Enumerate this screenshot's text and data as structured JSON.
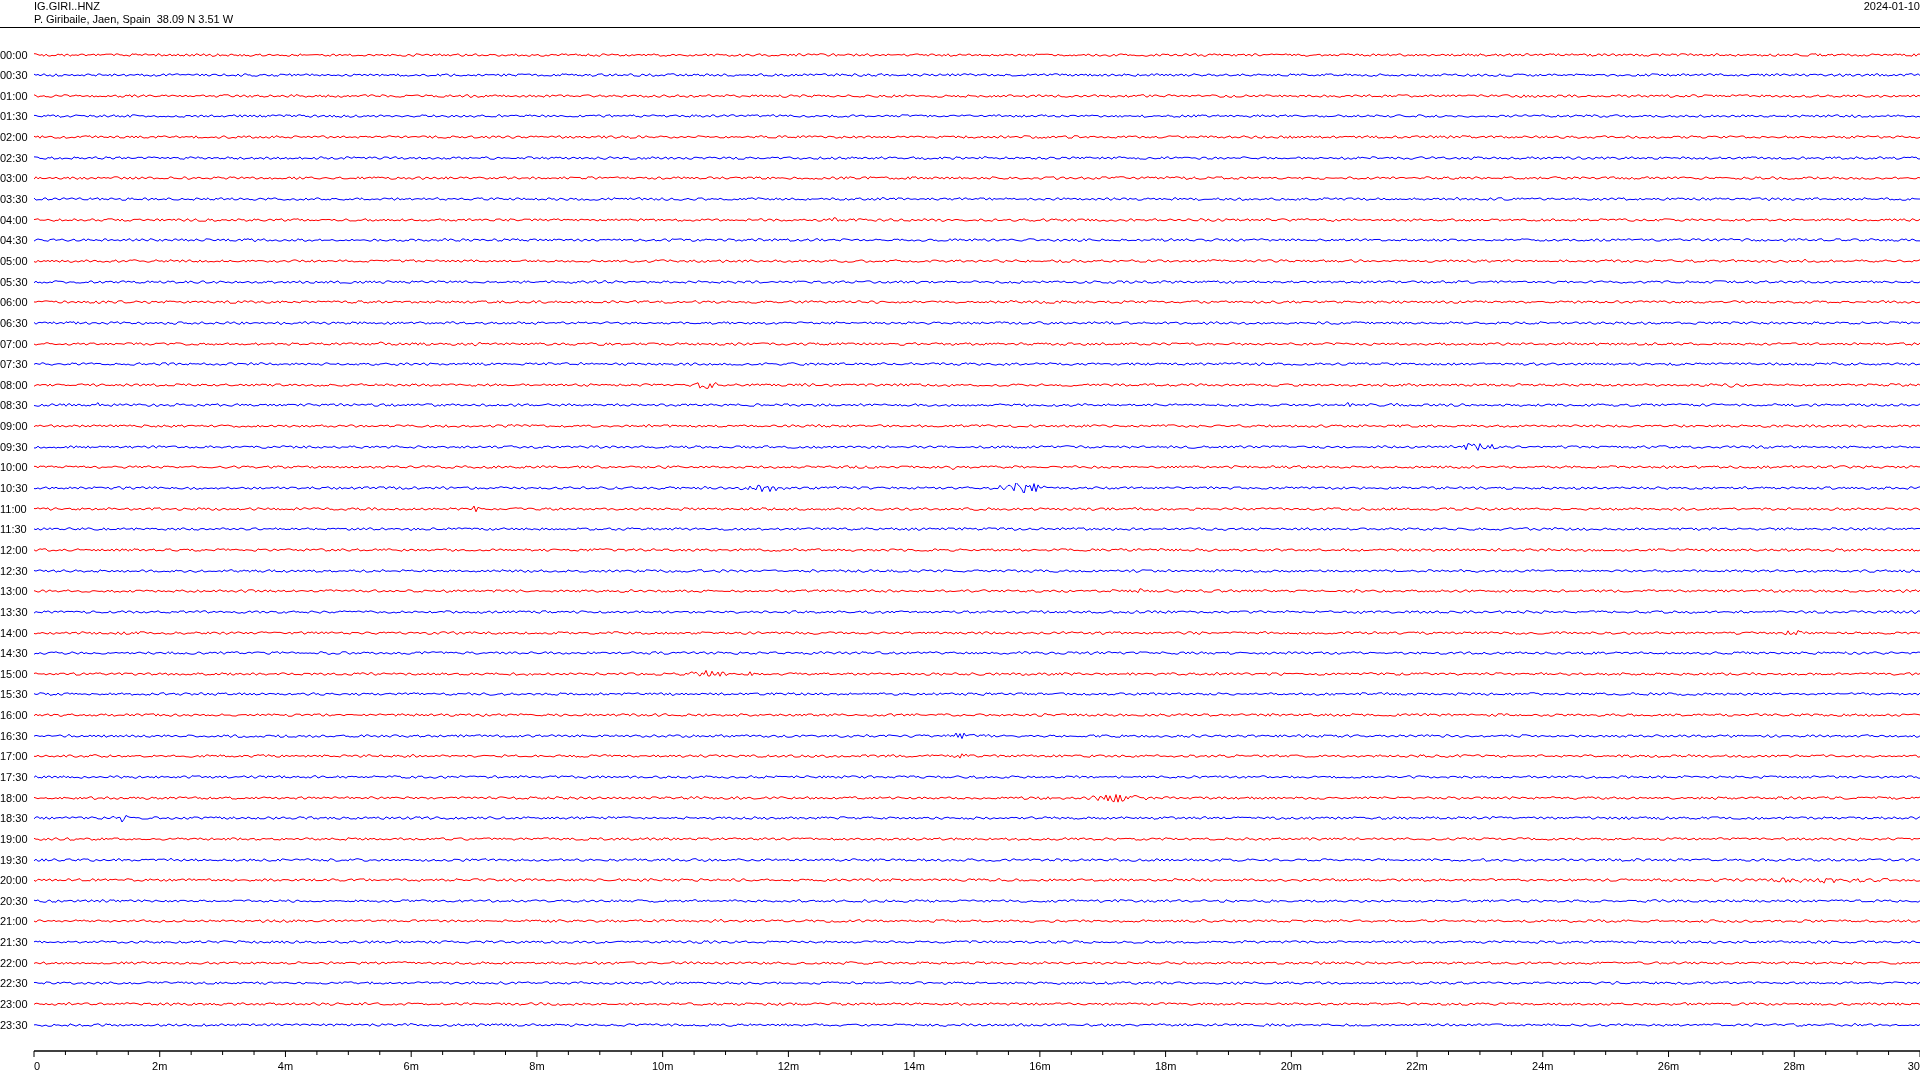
{
  "header": {
    "channel": "IG.GIRI..HNZ",
    "location": "P. Giribaile, Jaen, Spain  38.09 N 3.51 W",
    "date": "2024-01-10"
  },
  "traces": [
    {
      "label": "00:00",
      "color": "#ff0000"
    },
    {
      "label": "00:30",
      "color": "#0000ff"
    },
    {
      "label": "01:00",
      "color": "#ff0000"
    },
    {
      "label": "01:30",
      "color": "#0000ff"
    },
    {
      "label": "02:00",
      "color": "#ff0000"
    },
    {
      "label": "02:30",
      "color": "#0000ff"
    },
    {
      "label": "03:00",
      "color": "#ff0000"
    },
    {
      "label": "03:30",
      "color": "#0000ff"
    },
    {
      "label": "04:00",
      "color": "#ff0000"
    },
    {
      "label": "04:30",
      "color": "#0000ff"
    },
    {
      "label": "05:00",
      "color": "#ff0000"
    },
    {
      "label": "05:30",
      "color": "#0000ff"
    },
    {
      "label": "06:00",
      "color": "#ff0000"
    },
    {
      "label": "06:30",
      "color": "#0000ff"
    },
    {
      "label": "07:00",
      "color": "#ff0000"
    },
    {
      "label": "07:30",
      "color": "#0000ff"
    },
    {
      "label": "08:00",
      "color": "#ff0000"
    },
    {
      "label": "08:30",
      "color": "#0000ff"
    },
    {
      "label": "09:00",
      "color": "#ff0000"
    },
    {
      "label": "09:30",
      "color": "#0000ff"
    },
    {
      "label": "10:00",
      "color": "#ff0000"
    },
    {
      "label": "10:30",
      "color": "#0000ff"
    },
    {
      "label": "11:00",
      "color": "#ff0000"
    },
    {
      "label": "11:30",
      "color": "#0000ff"
    },
    {
      "label": "12:00",
      "color": "#ff0000"
    },
    {
      "label": "12:30",
      "color": "#0000ff"
    },
    {
      "label": "13:00",
      "color": "#ff0000"
    },
    {
      "label": "13:30",
      "color": "#0000ff"
    },
    {
      "label": "14:00",
      "color": "#ff0000"
    },
    {
      "label": "14:30",
      "color": "#0000ff"
    },
    {
      "label": "15:00",
      "color": "#ff0000"
    },
    {
      "label": "15:30",
      "color": "#0000ff"
    },
    {
      "label": "16:00",
      "color": "#ff0000"
    },
    {
      "label": "16:30",
      "color": "#0000ff"
    },
    {
      "label": "17:00",
      "color": "#ff0000"
    },
    {
      "label": "17:30",
      "color": "#0000ff"
    },
    {
      "label": "18:00",
      "color": "#ff0000"
    },
    {
      "label": "18:30",
      "color": "#0000ff"
    },
    {
      "label": "19:00",
      "color": "#ff0000"
    },
    {
      "label": "19:30",
      "color": "#0000ff"
    },
    {
      "label": "20:00",
      "color": "#ff0000"
    },
    {
      "label": "20:30",
      "color": "#0000ff"
    },
    {
      "label": "21:00",
      "color": "#ff0000"
    },
    {
      "label": "21:30",
      "color": "#0000ff"
    },
    {
      "label": "22:00",
      "color": "#ff0000"
    },
    {
      "label": "22:30",
      "color": "#0000ff"
    },
    {
      "label": "23:00",
      "color": "#ff0000"
    },
    {
      "label": "23:30",
      "color": "#0000ff"
    }
  ],
  "time_axis": {
    "ticks": [
      "0",
      "2m",
      "4m",
      "6m",
      "8m",
      "10m",
      "12m",
      "14m",
      "16m",
      "18m",
      "20m",
      "22m",
      "24m",
      "26m",
      "28m",
      "30"
    ]
  }
}
